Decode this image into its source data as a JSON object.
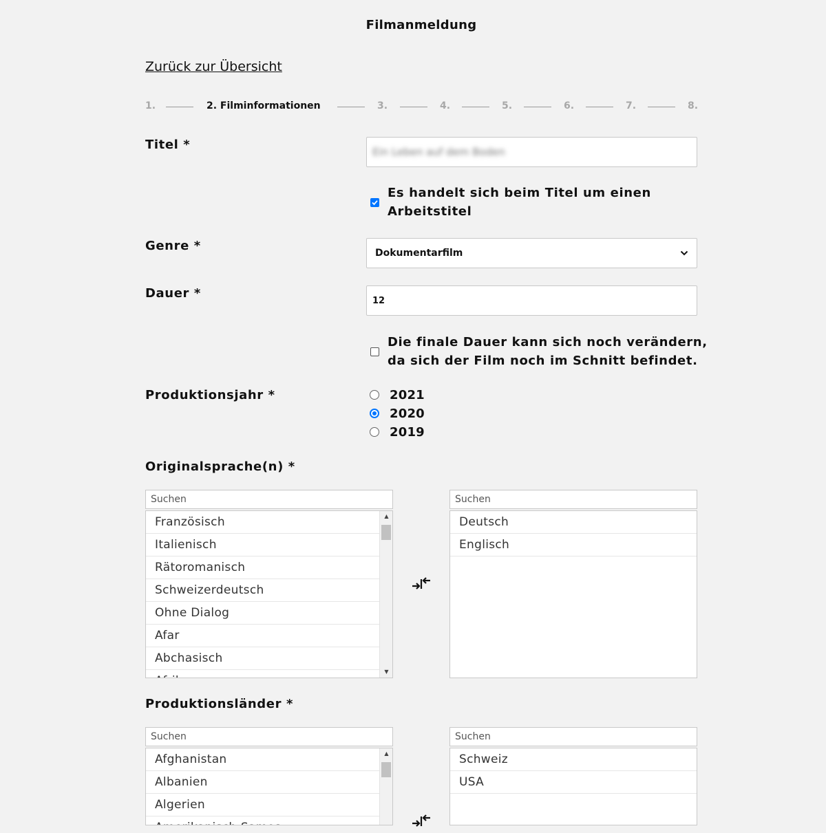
{
  "page_title": "Filmanmeldung",
  "back_link": "Zurück zur Übersicht",
  "steps": [
    "1.",
    "2. Filminformationen",
    "3.",
    "4.",
    "5.",
    "6.",
    "7.",
    "8."
  ],
  "title_field": {
    "label": "Titel *",
    "value": "Ein Leben auf dem Boden",
    "working_title_checkbox": {
      "label_line1": "Es handelt sich beim Titel um einen",
      "label_line2": "Arbeitstitel",
      "checked": true
    }
  },
  "genre_field": {
    "label": "Genre *",
    "selected": "Dokumentarfilm",
    "icon": "chevron-down-icon"
  },
  "duration_field": {
    "label": "Dauer *",
    "value": "12",
    "final_duration_checkbox": {
      "label_line1": "Die finale Dauer kann sich noch verändern,",
      "label_line2": "da sich der Film noch im Schnitt befindet.",
      "checked": false
    }
  },
  "production_year": {
    "label": "Produktionsjahr *",
    "options": [
      "2021",
      "2020",
      "2019"
    ],
    "selected": "2020"
  },
  "original_languages": {
    "label": "Originalsprache(n) *",
    "available_search_placeholder": "Suchen",
    "selected_search_placeholder": "Suchen",
    "available": [
      "Französisch",
      "Italienisch",
      "Rätoromanisch",
      "Schweizerdeutsch",
      "Ohne Dialog",
      "Afar",
      "Abchasisch",
      "Afrikaans"
    ],
    "selected": [
      "Deutsch",
      "Englisch"
    ],
    "transfer_icon": "transfer-arrows-icon"
  },
  "production_countries": {
    "label": "Produktionsländer *",
    "available_search_placeholder": "Suchen",
    "selected_search_placeholder": "Suchen",
    "available": [
      "Afghanistan",
      "Albanien",
      "Algerien",
      "Amerikanisch-Samoa"
    ],
    "selected": [
      "Schweiz",
      "USA"
    ],
    "transfer_icon": "transfer-arrows-icon"
  },
  "colors": {
    "accent": "#0075ff",
    "background": "#f2f2f2"
  }
}
